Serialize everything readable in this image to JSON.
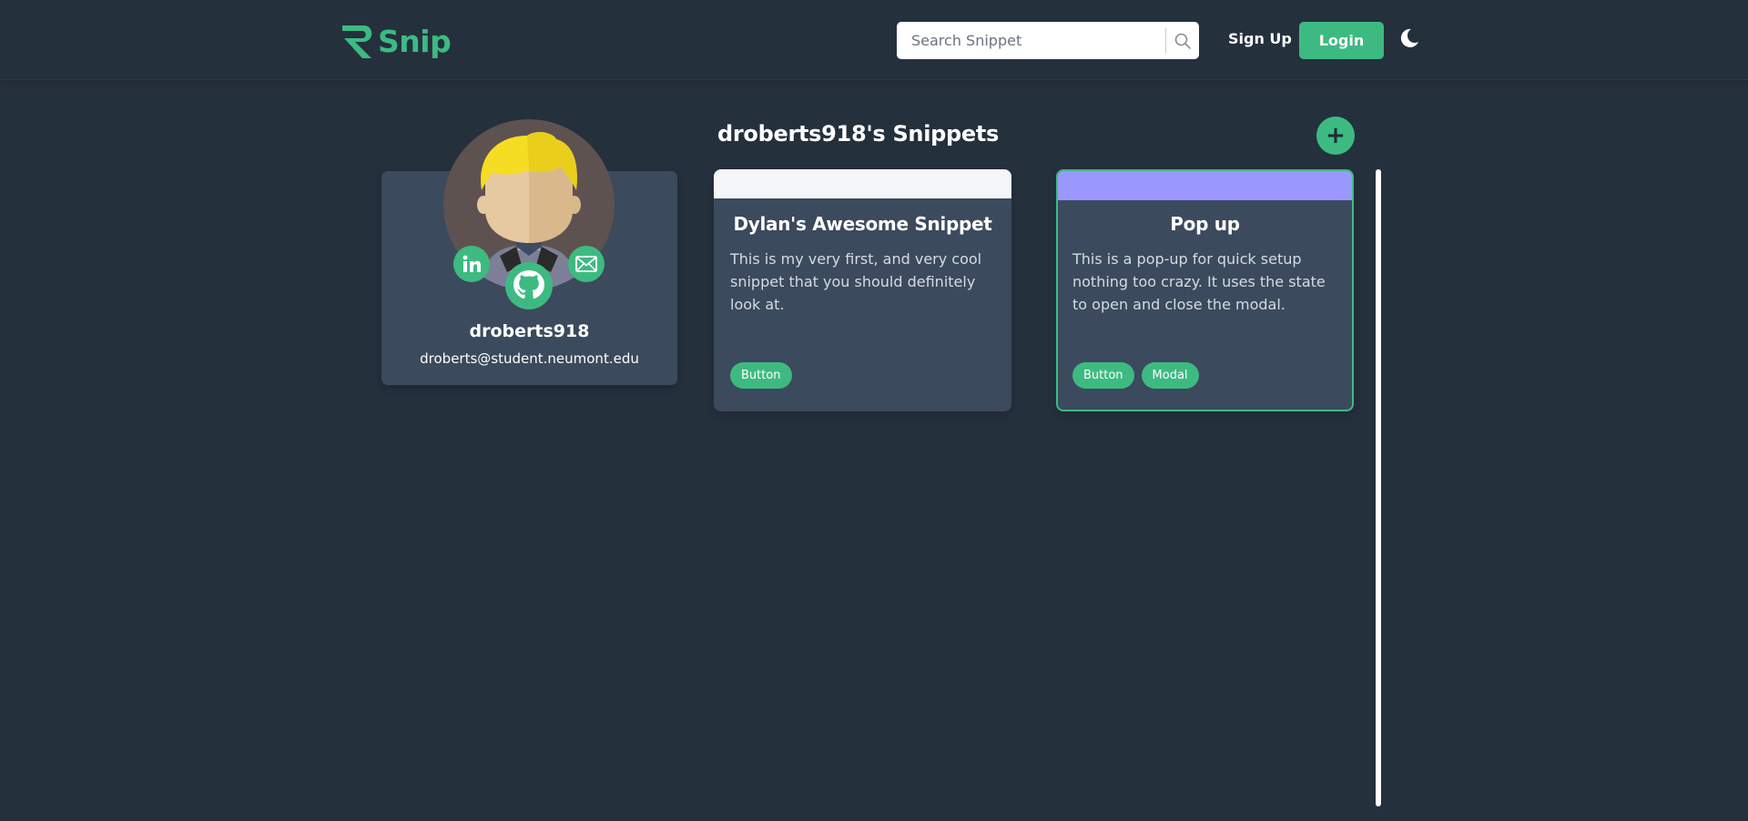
{
  "header": {
    "logo_text": "Snip",
    "search_placeholder": "Search Snippet",
    "signup_label": "Sign Up",
    "login_label": "Login"
  },
  "profile": {
    "username": "droberts918",
    "email": "droberts@student.neumont.edu",
    "social_icons": [
      "linkedin-icon",
      "github-icon",
      "email-icon"
    ]
  },
  "main": {
    "title": "droberts918's Snippets",
    "add_label": "+"
  },
  "snippets": [
    {
      "title": "Dylan's Awesome Snippet",
      "description": "This is my very first, and very cool snippet that you should definitely look at.",
      "bar_color": "#f5f6f7",
      "tags": [
        "Button"
      ]
    },
    {
      "title": "Pop up",
      "description": "This is a pop-up for quick setup nothing too crazy. It uses the state to open and close the modal.",
      "bar_color": "#9a98ff",
      "tags": [
        "Button",
        "Modal"
      ]
    }
  ],
  "colors": {
    "background": "#25303d",
    "card": "#3b4a5c",
    "accent": "#3dba82"
  }
}
